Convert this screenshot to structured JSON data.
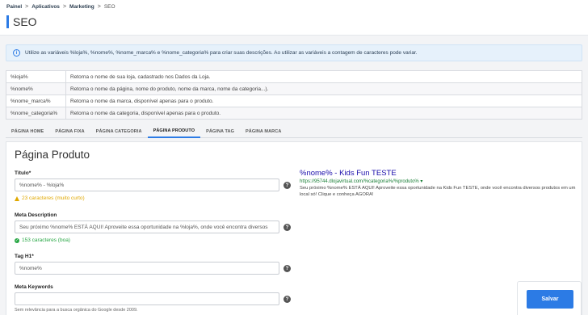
{
  "breadcrumb": {
    "items": [
      "Painel",
      "Aplicativos",
      "Marketing"
    ],
    "current": "SEO",
    "separator": ">"
  },
  "page_title": "SEO",
  "info": {
    "icon": "info-icon",
    "text": "Utilize as variáveis %loja%, %nome%, %nome_marca% e %nome_categoria% para criar suas descrições. Ao utilizar as variáveis a contagem de caracteres pode variar."
  },
  "variables": [
    {
      "key": "%loja%",
      "desc": "Retorna o nome de sua loja, cadastrado nos Dados da Loja."
    },
    {
      "key": "%nome%",
      "desc": "Retorna o nome da página, nome do produto, nome da marca, nome da categoria...)."
    },
    {
      "key": "%nome_marca%",
      "desc": "Retorna o nome da marca, disponível apenas para o produto."
    },
    {
      "key": "%nome_categoria%",
      "desc": "Retorna o nome da categoria, disponível apenas para o produto."
    }
  ],
  "tabs": [
    "PÁGINA HOME",
    "PÁGINA FIXA",
    "PÁGINA CATEGORIA",
    "PÁGINA PRODUTO",
    "PÁGINA TAG",
    "PÁGINA MARCA"
  ],
  "active_tab": "PÁGINA PRODUTO",
  "form": {
    "section_title": "Página Produto",
    "title_label": "Título*",
    "title_value": "%nome% - %loja%",
    "title_note": "23 caracteres (muito curto)",
    "meta_label": "Meta Description",
    "meta_value": "Seu próximo %nome% ESTÁ AQUI! Aproveite essa oportunidade na %loja%, onde você encontra diversos",
    "meta_note": "153 caracteres (boa)",
    "h1_label": "Tag H1*",
    "h1_value": "%nome%",
    "keywords_label": "Meta Keywords",
    "keywords_value": "",
    "keywords_note": "Sem relevância para a busca orgânica do Google desde 2009.",
    "help_symbol": "?"
  },
  "preview": {
    "title": "%nome% - Kids Fun TESTE",
    "url": "https://95744.dlojavirtual.com/%categoria%/%produto% ▾",
    "description": "Seu próximo %nome% ESTÁ AQUI! Aproveite essa oportunidade na Kids Fun TESTE, onde você encontra diversos produtos em um local só! Clique e conheça AGORA!"
  },
  "save_label": "Salvar",
  "colors": {
    "accent": "#2c7be5",
    "warning": "#e0a800",
    "success": "#28a745",
    "link": "#1a0dab",
    "url": "#1a7f37"
  }
}
